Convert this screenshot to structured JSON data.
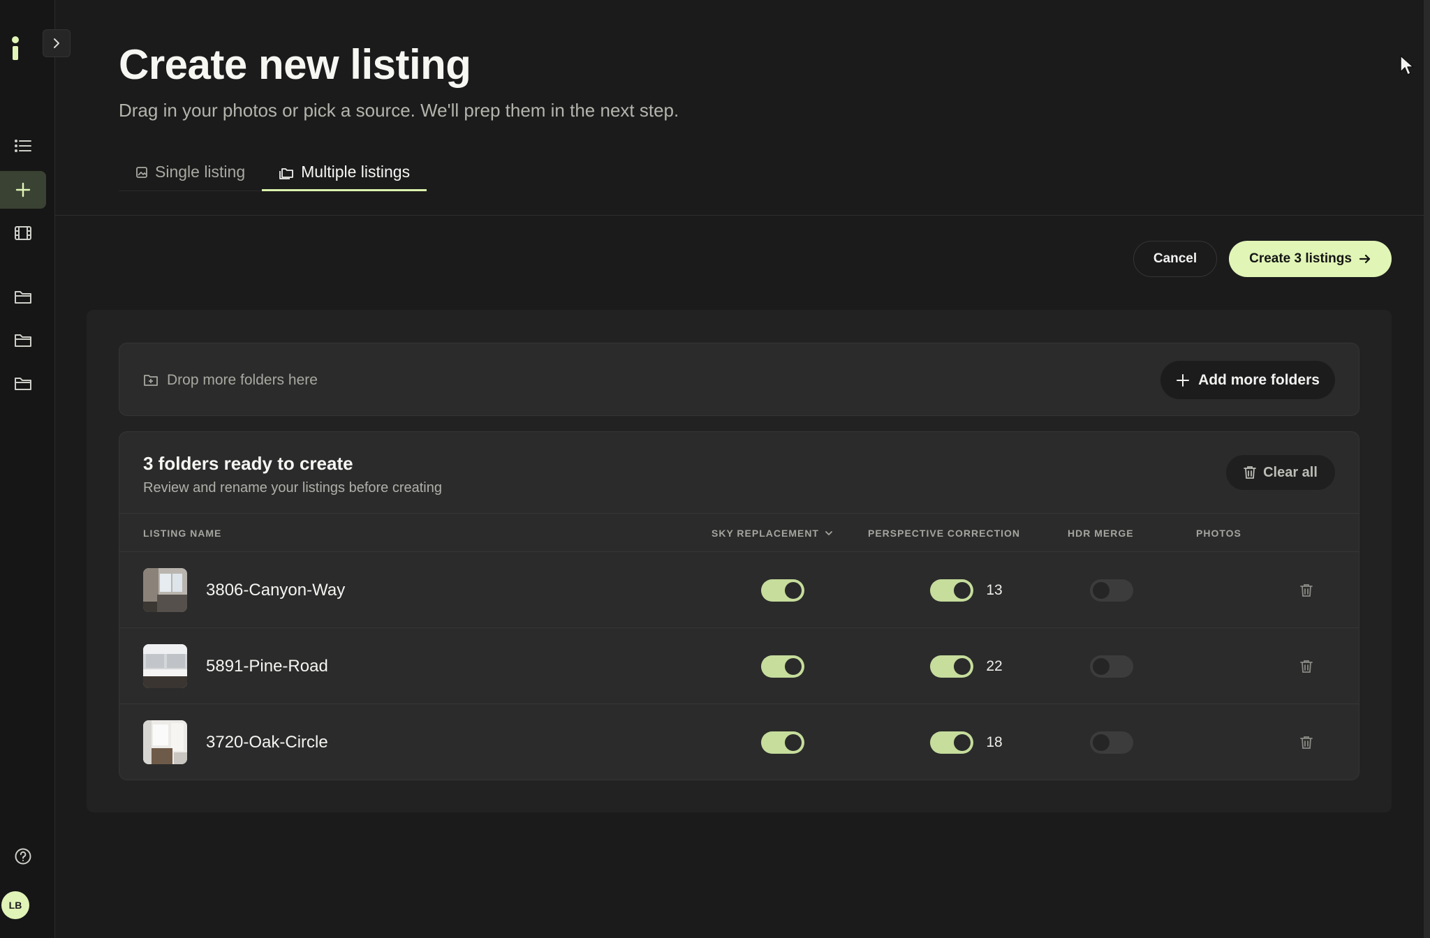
{
  "header": {
    "title": "Create new listing",
    "subtitle": "Drag in your photos or pick a source. We'll prep them in the next step."
  },
  "tabs": [
    {
      "label": "Single listing",
      "icon": "image-icon",
      "active": false
    },
    {
      "label": "Multiple listings",
      "icon": "folders-icon",
      "active": true
    }
  ],
  "actions": {
    "cancel_label": "Cancel",
    "create_label": "Create 3 listings"
  },
  "dropzone": {
    "label": "Drop more folders here",
    "add_label": "Add more folders"
  },
  "list": {
    "title": "3 folders ready to create",
    "subtitle": "Review and rename your listings before creating",
    "clear_label": "Clear all",
    "columns": {
      "name": "LISTING NAME",
      "sky": "SKY REPLACEMENT",
      "perspective": "PERSPECTIVE CORRECTION",
      "hdr": "HDR MERGE",
      "photos": "PHOTOS"
    },
    "rows": [
      {
        "name": "3806-Canyon-Way",
        "sky": true,
        "perspective": true,
        "hdr": false,
        "photos": "13"
      },
      {
        "name": "5891-Pine-Road",
        "sky": true,
        "perspective": true,
        "hdr": false,
        "photos": "22"
      },
      {
        "name": "3720-Oak-Circle",
        "sky": true,
        "perspective": true,
        "hdr": false,
        "photos": "18"
      }
    ]
  },
  "sidebar": {
    "avatar_initials": "LB",
    "accent_color": "#e1f5b6"
  }
}
